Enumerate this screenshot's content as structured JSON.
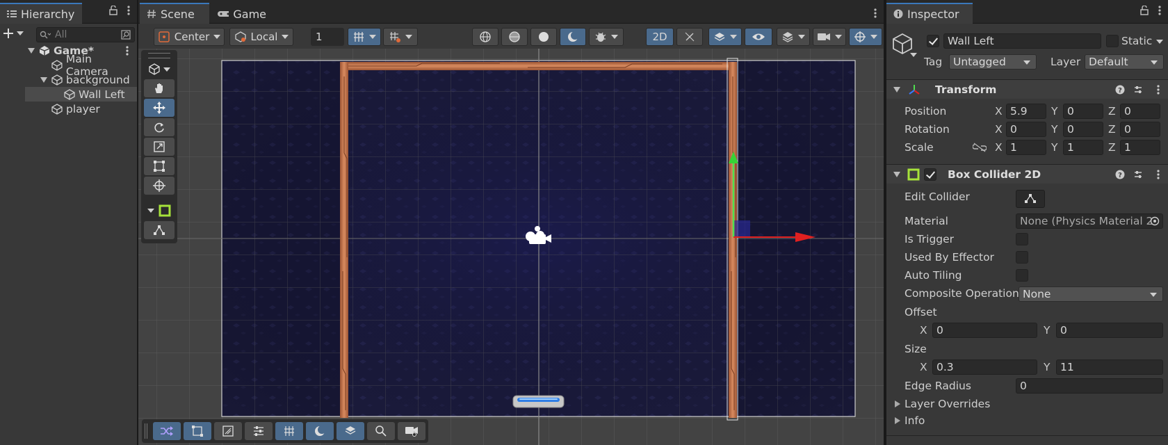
{
  "hierarchy": {
    "tab_label": "Hierarchy",
    "search_placeholder": "All",
    "items": [
      {
        "label": "Game*"
      },
      {
        "label": "Main Camera"
      },
      {
        "label": "background"
      },
      {
        "label": "Wall Left"
      },
      {
        "label": "player"
      }
    ]
  },
  "scene": {
    "tabs": [
      {
        "label": "Scene"
      },
      {
        "label": "Game"
      }
    ],
    "toolbar": {
      "pivot_mode": "Center",
      "pivot_rotation": "Local",
      "grid_size": "1",
      "mode_2d": "2D"
    }
  },
  "inspector": {
    "tab_label": "Inspector",
    "object_name": "Wall Left",
    "static_label": "Static",
    "tag_label": "Tag",
    "tag_value": "Untagged",
    "layer_label": "Layer",
    "layer_value": "Default",
    "transform": {
      "title": "Transform",
      "position_label": "Position",
      "rotation_label": "Rotation",
      "scale_label": "Scale",
      "position": {
        "x": "5.9",
        "y": "0",
        "z": "0"
      },
      "rotation": {
        "x": "0",
        "y": "0",
        "z": "0"
      },
      "scale": {
        "x": "1",
        "y": "1",
        "z": "1"
      }
    },
    "box_collider": {
      "title": "Box Collider 2D",
      "edit_collider_label": "Edit Collider",
      "material_label": "Material",
      "material_value": "None (Physics Material 2",
      "is_trigger_label": "Is Trigger",
      "used_by_effector_label": "Used By Effector",
      "auto_tiling_label": "Auto Tiling",
      "composite_label": "Composite Operation",
      "composite_value": "None",
      "offset_label": "Offset",
      "offset": {
        "x": "0",
        "y": "0"
      },
      "size_label": "Size",
      "size": {
        "x": "0.3",
        "y": "11"
      },
      "edge_radius_label": "Edge Radius",
      "edge_radius_value": "0",
      "layer_overrides_label": "Layer Overrides",
      "info_label": "Info"
    },
    "axis_labels": {
      "x": "X",
      "y": "Y",
      "z": "Z"
    }
  },
  "colors": {
    "accent": "#3a79bb",
    "wall": "#c77a52",
    "background_dark": "#1a1a3a",
    "gizmo_x": "#e02020",
    "gizmo_y": "#36d336"
  }
}
